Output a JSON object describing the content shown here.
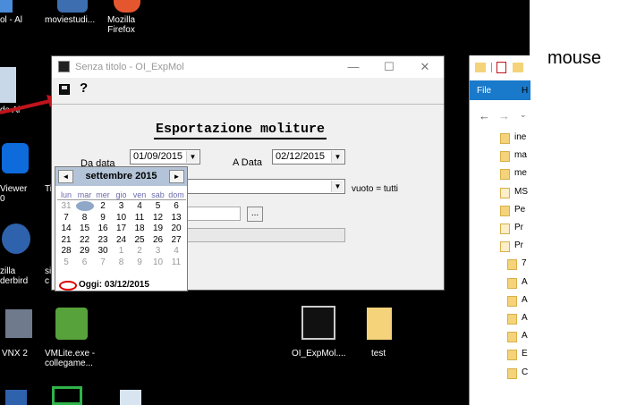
{
  "desktop": {
    "top_icons": [
      {
        "label": "ol - Al"
      },
      {
        "label": "moviestudi..."
      },
      {
        "label": "Mozilla\nFirefox"
      }
    ],
    "left_icons": [
      {
        "label": "Viewer\n0"
      },
      {
        "label": "zilla\nderbird"
      },
      {
        "label": "VNX 2"
      }
    ],
    "bottom_icons": [
      {
        "label": "VMLite.exe -\ncollegame..."
      },
      {
        "label": "OI_ExpMol...."
      },
      {
        "label": "test"
      }
    ],
    "partial_labels": {
      "a": "de Al",
      "b": "Ti",
      "c": "C",
      "d": "C",
      "e": "c",
      "f": "si"
    }
  },
  "window": {
    "title": "Senza titolo - OI_ExpMol",
    "controls": {
      "min": "—",
      "max": "☐",
      "close": "✕"
    },
    "toolbar": {
      "save_icon": "floppy-disk",
      "help_icon": "question"
    }
  },
  "form": {
    "title": "Esportazione moliture",
    "da_data_label": "Da data",
    "da_data_value": "01/09/2015",
    "a_data_label": "A Data",
    "a_data_value": "02/12/2015",
    "vuoto_label": "vuoto = tutti",
    "browse_button": "..."
  },
  "calendar": {
    "prev": "◄",
    "next": "►",
    "month": "settembre 2015",
    "dow": [
      "lun",
      "mar",
      "mer",
      "gio",
      "ven",
      "sab",
      "dom"
    ],
    "weeks": [
      [
        "31",
        "1",
        "2",
        "3",
        "4",
        "5",
        "6"
      ],
      [
        "7",
        "8",
        "9",
        "10",
        "11",
        "12",
        "13"
      ],
      [
        "14",
        "15",
        "16",
        "17",
        "18",
        "19",
        "20"
      ],
      [
        "21",
        "22",
        "23",
        "24",
        "25",
        "26",
        "27"
      ],
      [
        "28",
        "29",
        "30",
        "1",
        "2",
        "3",
        "4"
      ],
      [
        "5",
        "6",
        "7",
        "8",
        "9",
        "10",
        "11"
      ]
    ],
    "selected_day": "1",
    "today": "Oggi: 03/12/2015"
  },
  "explorer": {
    "file_tab": "File",
    "tab2": "H",
    "items": [
      "ine",
      "ma",
      "me",
      "MS",
      "Pe",
      "Pr",
      "Pr",
      "7",
      "A",
      "A",
      "A",
      "A",
      "E",
      "C"
    ]
  },
  "annotation": {
    "mouse_label": "mouse",
    "arrow_color": "#c0141c"
  },
  "colors": {
    "desktop_bg": "#000000",
    "calendar_header": "#b4c4d8",
    "explorer_ribbon": "#1979ca"
  }
}
